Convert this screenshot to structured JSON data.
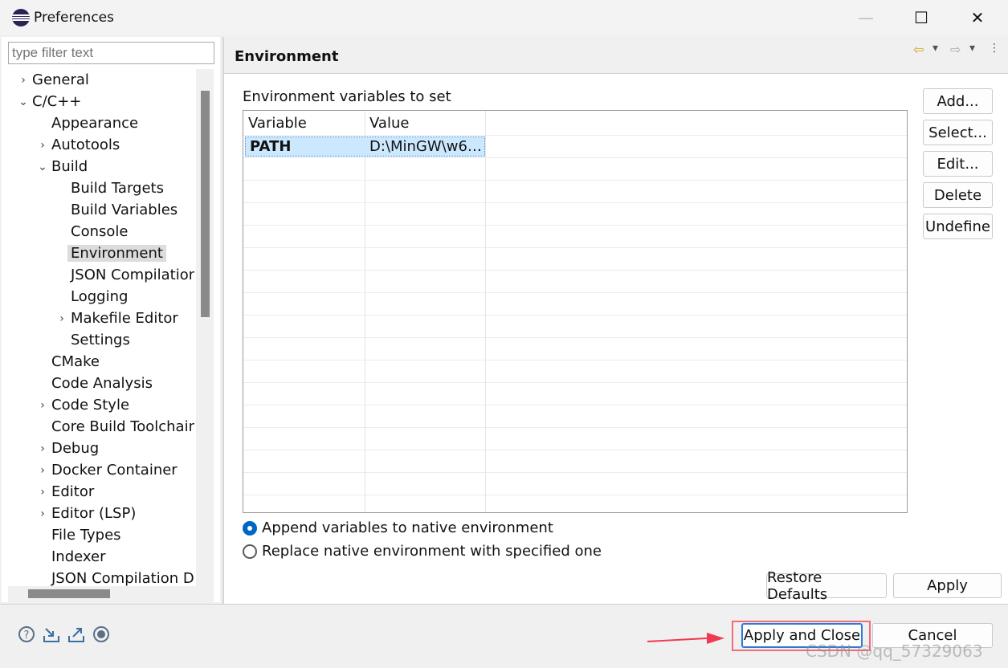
{
  "window": {
    "title": "Preferences",
    "controls": {
      "minimize": "—",
      "maximize": "☐",
      "close": "✕"
    }
  },
  "filter": {
    "placeholder": "type filter text"
  },
  "tree": [
    {
      "label": "General",
      "level": 0,
      "expander": "›",
      "selected": false
    },
    {
      "label": "C/C++",
      "level": 0,
      "expander": "⌄",
      "selected": false
    },
    {
      "label": "Appearance",
      "level": 1,
      "expander": "",
      "selected": false
    },
    {
      "label": "Autotools",
      "level": 1,
      "expander": "›",
      "selected": false
    },
    {
      "label": "Build",
      "level": 1,
      "expander": "⌄",
      "selected": false
    },
    {
      "label": "Build Targets",
      "level": 2,
      "expander": "",
      "selected": false
    },
    {
      "label": "Build Variables",
      "level": 2,
      "expander": "",
      "selected": false
    },
    {
      "label": "Console",
      "level": 2,
      "expander": "",
      "selected": false
    },
    {
      "label": "Environment",
      "level": 2,
      "expander": "",
      "selected": true
    },
    {
      "label": "JSON Compilation",
      "level": 2,
      "expander": "",
      "selected": false
    },
    {
      "label": "Logging",
      "level": 2,
      "expander": "",
      "selected": false
    },
    {
      "label": "Makefile Editor",
      "level": 2,
      "expander": "›",
      "selected": false
    },
    {
      "label": "Settings",
      "level": 2,
      "expander": "",
      "selected": false
    },
    {
      "label": "CMake",
      "level": 1,
      "expander": "",
      "selected": false
    },
    {
      "label": "Code Analysis",
      "level": 1,
      "expander": "",
      "selected": false
    },
    {
      "label": "Code Style",
      "level": 1,
      "expander": "›",
      "selected": false
    },
    {
      "label": "Core Build Toolchains",
      "level": 1,
      "expander": "",
      "selected": false
    },
    {
      "label": "Debug",
      "level": 1,
      "expander": "›",
      "selected": false
    },
    {
      "label": "Docker Container",
      "level": 1,
      "expander": "›",
      "selected": false
    },
    {
      "label": "Editor",
      "level": 1,
      "expander": "›",
      "selected": false
    },
    {
      "label": "Editor (LSP)",
      "level": 1,
      "expander": "›",
      "selected": false
    },
    {
      "label": "File Types",
      "level": 1,
      "expander": "",
      "selected": false
    },
    {
      "label": "Indexer",
      "level": 1,
      "expander": "",
      "selected": false
    },
    {
      "label": "JSON Compilation Da",
      "level": 1,
      "expander": "",
      "selected": false
    }
  ],
  "page": {
    "title": "Environment",
    "section_label": "Environment variables to set",
    "table": {
      "columns": [
        "Variable",
        "Value"
      ],
      "rows": [
        {
          "variable": "PATH",
          "value": "D:\\MinGW\\w6…",
          "selected": true
        }
      ]
    },
    "side_buttons": [
      "Add...",
      "Select...",
      "Edit...",
      "Delete",
      "Undefine"
    ],
    "radios": [
      {
        "label": "Append variables to native environment",
        "checked": true
      },
      {
        "label": "Replace native environment with specified one",
        "checked": false
      }
    ],
    "restore_defaults": "Restore Defaults",
    "apply": "Apply"
  },
  "nav": {
    "back": "⇦",
    "back_menu": "▾",
    "forward": "⇨",
    "forward_menu": "▾",
    "more": "⋮"
  },
  "footer": {
    "apply_and_close": "Apply and Close",
    "cancel": "Cancel",
    "icons": [
      "help-icon",
      "import-icon",
      "export-icon",
      "oomph-record-icon"
    ]
  },
  "annotation": {
    "color": "#f26b7a"
  },
  "watermark": "CSDN @qq_57329063",
  "colors": {
    "selection": "#cce8ff",
    "radio_accent": "#0067c0",
    "highlight": "#f26b7a"
  }
}
